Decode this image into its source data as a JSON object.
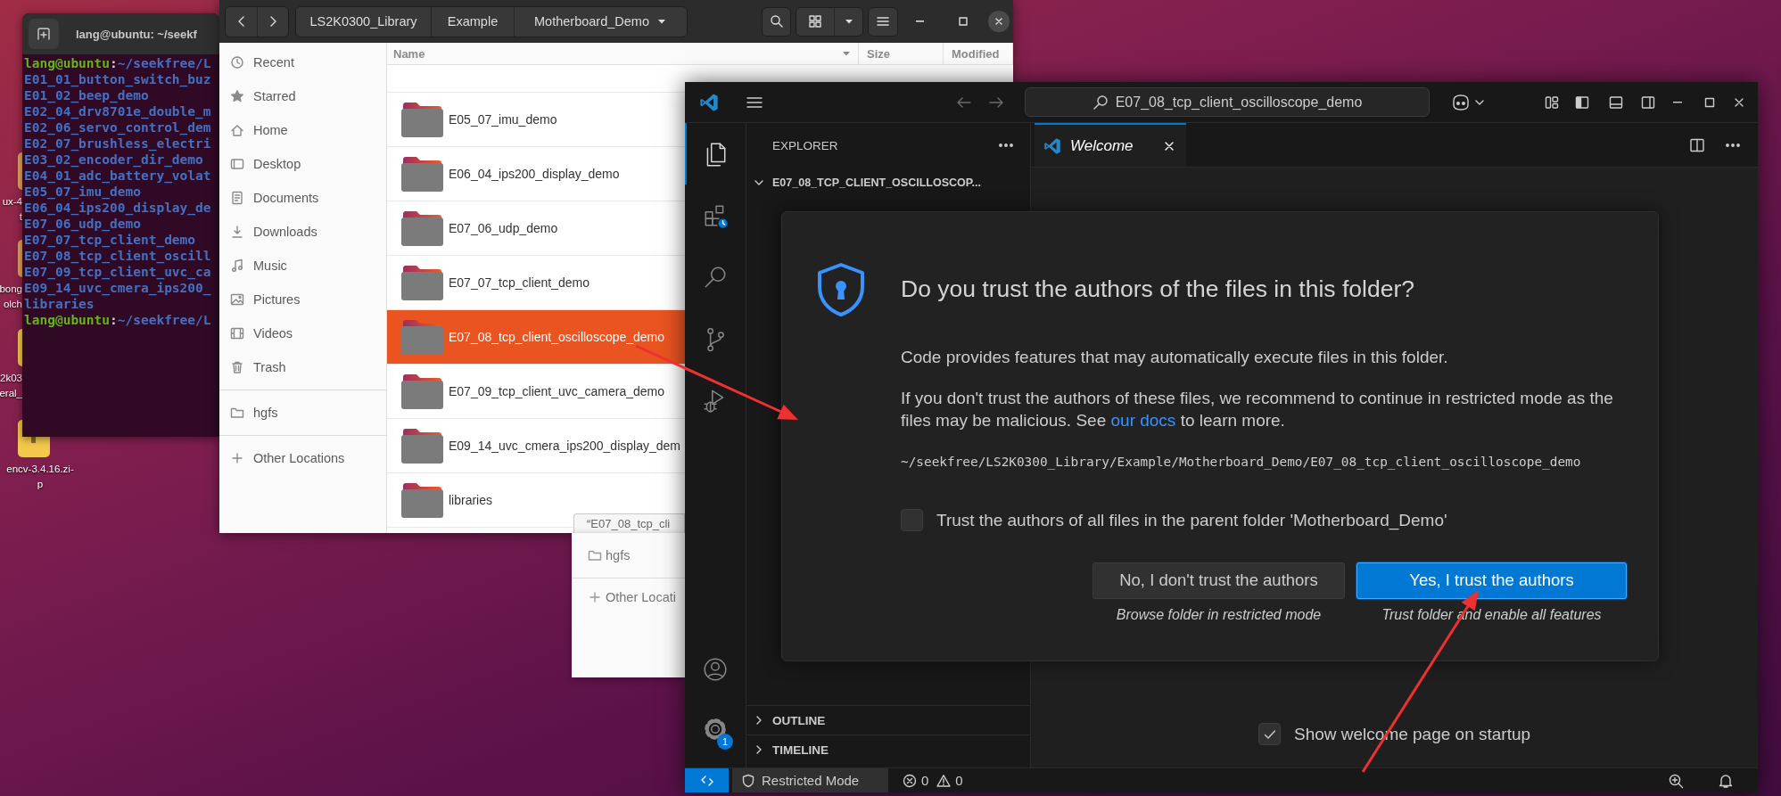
{
  "desktop_icons": [
    {
      "kind": "archive",
      "lines": [
        "ux-4",
        "t"
      ]
    },
    {
      "kind": "archive",
      "lines": [
        "bong",
        "olch"
      ]
    },
    {
      "kind": "zip",
      "lines": [
        "2k03",
        "eral_"
      ]
    },
    {
      "kind": "zip",
      "lines": [
        "encv-3.4.16.zi-",
        "p"
      ]
    }
  ],
  "terminal": {
    "title": "lang@ubuntu: ~/seekf",
    "lines": [
      {
        "kind": "prompt",
        "user": "lang@ubuntu",
        "separator": ":",
        "path": "~/seekfree/L"
      },
      {
        "kind": "entry",
        "text": "E01_01_button_switch_buz"
      },
      {
        "kind": "entry",
        "text": "E01_02_beep_demo"
      },
      {
        "kind": "entry",
        "text": "E02_04_drv8701e_double_m"
      },
      {
        "kind": "entry",
        "text": "E02_06_servo_control_dem"
      },
      {
        "kind": "entry",
        "text": "E02_07_brushless_electri"
      },
      {
        "kind": "entry",
        "text": "E03_02_encoder_dir_demo"
      },
      {
        "kind": "entry",
        "text": "E04_01_adc_battery_volat"
      },
      {
        "kind": "entry",
        "text": "E05_07_imu_demo"
      },
      {
        "kind": "entry",
        "text": "E06_04_ips200_display_de"
      },
      {
        "kind": "entry",
        "text": "E07_06_udp_demo"
      },
      {
        "kind": "entry",
        "text": "E07_07_tcp_client_demo"
      },
      {
        "kind": "entry",
        "text": "E07_08_tcp_client_oscill"
      },
      {
        "kind": "entry",
        "text": "E07_09_tcp_client_uvc_ca"
      },
      {
        "kind": "entry",
        "text": "E09_14_uvc_cmera_ips200_"
      },
      {
        "kind": "entry",
        "text": "libraries"
      },
      {
        "kind": "prompt",
        "user": "lang@ubuntu",
        "separator": ":",
        "path": "~/seekfree/L"
      }
    ]
  },
  "files": {
    "path": [
      "LS2K0300_Library",
      "Example",
      "Motherboard_Demo"
    ],
    "sidebar": [
      {
        "items": [
          {
            "kind": "recent",
            "label": "Recent"
          },
          {
            "kind": "starred",
            "label": "Starred"
          },
          {
            "kind": "home",
            "label": "Home"
          },
          {
            "kind": "desktop",
            "label": "Desktop"
          },
          {
            "kind": "documents",
            "label": "Documents"
          },
          {
            "kind": "downloads",
            "label": "Downloads"
          },
          {
            "kind": "music",
            "label": "Music"
          },
          {
            "kind": "pictures",
            "label": "Pictures"
          },
          {
            "kind": "videos",
            "label": "Videos"
          },
          {
            "kind": "trash",
            "label": "Trash"
          }
        ]
      },
      {
        "items": [
          {
            "kind": "folder",
            "label": "hgfs"
          }
        ]
      },
      {
        "items": [
          {
            "kind": "add",
            "label": "Other Locations"
          }
        ]
      }
    ],
    "columns": [
      "Name",
      "Size",
      "Modified"
    ],
    "rows": [
      {
        "name": "E05_07_imu_demo",
        "selected": false
      },
      {
        "name": "E06_04_ips200_display_demo",
        "selected": false
      },
      {
        "name": "E07_06_udp_demo",
        "selected": false
      },
      {
        "name": "E07_07_tcp_client_demo",
        "selected": false
      },
      {
        "name": "E07_08_tcp_client_oscilloscope_demo",
        "selected": true
      },
      {
        "name": "E07_09_tcp_client_uvc_camera_demo",
        "selected": false
      },
      {
        "name": "E09_14_uvc_cmera_ips200_display_dem",
        "selected": false
      },
      {
        "name": "libraries",
        "selected": false
      }
    ]
  },
  "drag_tooltip": "“E07_08_tcp_cli",
  "ghost_sidebar": [
    {
      "items": [
        {
          "kind": "folder",
          "label": "hgfs"
        }
      ]
    },
    {
      "items": [
        {
          "kind": "add",
          "label": "Other Locati"
        }
      ]
    }
  ],
  "vscode": {
    "search": "E07_08_tcp_client_oscilloscope_demo",
    "activity": [
      {
        "kind": "explorer",
        "selected": true
      },
      {
        "kind": "extensions",
        "selected": false
      },
      {
        "kind": "search",
        "selected": false
      },
      {
        "kind": "scm",
        "selected": false
      },
      {
        "kind": "debug",
        "selected": false
      }
    ],
    "activity_bottom": [
      {
        "kind": "account"
      },
      {
        "kind": "settings",
        "badge": "1"
      }
    ],
    "explorer": {
      "title": "EXPLORER",
      "folder": "E07_08_TCP_CLIENT_OSCILLOSCOP...",
      "expanded": true
    },
    "panels": [
      {
        "label": "OUTLINE",
        "expanded": false
      },
      {
        "label": "TIMELINE",
        "expanded": false
      }
    ],
    "tabs": [
      {
        "label": "Welcome",
        "selected": true
      }
    ],
    "welcome_checkbox": {
      "label": "Show welcome page on startup",
      "checked": true
    },
    "status": {
      "mode": "Restricted Mode",
      "errors": "0",
      "warnings": "0"
    }
  },
  "dialog": {
    "title": "Do you trust the authors of the files in this folder?",
    "paragraphs": [
      {
        "text": "Code provides features that may automatically execute files in this folder."
      },
      {
        "text": "If you don't trust the authors of these files, we recommend to continue in restricted mode as the files may be malicious. See ",
        "link": "our docs",
        "after": " to learn more."
      }
    ],
    "path": "~/seekfree/LS2K0300_Library/Example/Motherboard_Demo/E07_08_tcp_client_oscilloscope_demo",
    "checkbox": {
      "label": "Trust the authors of all files in the parent folder 'Motherboard_Demo'",
      "checked": false
    },
    "buttons": [
      {
        "label": "No, I don't trust the authors",
        "caption": "Browse folder in restricted mode",
        "primary": false
      },
      {
        "label": "Yes, I trust the authors",
        "caption": "Trust folder and enable all features",
        "primary": true
      }
    ]
  }
}
